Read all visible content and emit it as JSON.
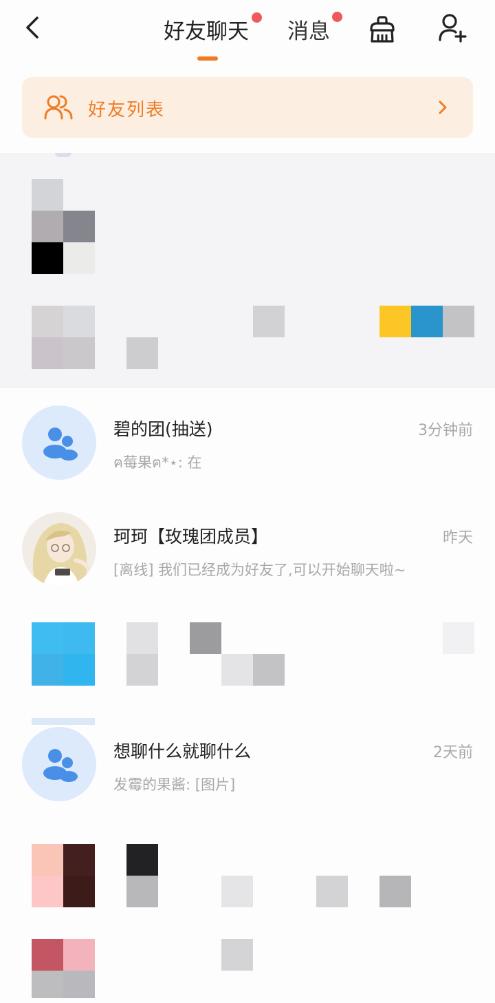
{
  "header": {
    "tabs": [
      {
        "label": "好友聊天",
        "active": true,
        "has_dot": true
      },
      {
        "label": "消息",
        "active": false,
        "has_dot": true
      }
    ],
    "icons": [
      "back-icon",
      "clean-icon",
      "add-user-icon"
    ]
  },
  "friend_list_card": {
    "label": "好友列表",
    "icon": "group-icon"
  },
  "chats": [
    {
      "name": "碧的团(抽送)",
      "time": "3分钟前",
      "preview": "ฅ莓果ฅ*⋆: 在",
      "avatar": "group-avatar-icon"
    },
    {
      "name": "珂珂【玫瑰团成员】",
      "time": "昨天",
      "preview": "[离线] 我们已经成为好友了,可以开始聊天啦~",
      "avatar": "anime-avatar"
    },
    {
      "name": "想聊什么就聊什么",
      "time": "2天前",
      "preview": "发霉的果酱: [图片]",
      "avatar": "group-avatar-icon"
    }
  ],
  "colors": {
    "accent": "#f07b22",
    "card_bg": "#fdeee2",
    "card_text": "#ee7d26",
    "red_dot": "#ee5a5a",
    "group_icon_blue": "#4a8fe7",
    "avatar_bg": "#dceafc",
    "muted_text": "#a8a8a8"
  }
}
